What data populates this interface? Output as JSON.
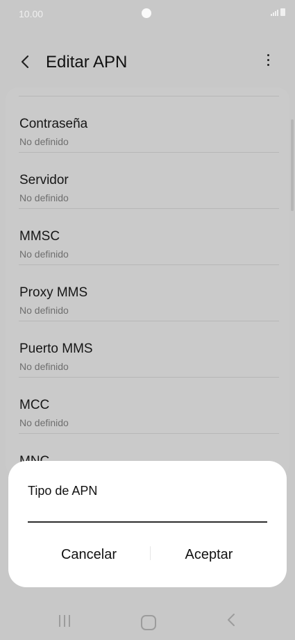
{
  "status_bar": {
    "time": "10.00"
  },
  "header": {
    "title": "Editar APN"
  },
  "settings": [
    {
      "label": "Contraseña",
      "value": "No definido"
    },
    {
      "label": "Servidor",
      "value": "No definido"
    },
    {
      "label": "MMSC",
      "value": "No definido"
    },
    {
      "label": "Proxy MMS",
      "value": "No definido"
    },
    {
      "label": "Puerto MMS",
      "value": "No definido"
    },
    {
      "label": "MCC",
      "value": "No definido"
    },
    {
      "label": "MNC",
      "value": ""
    }
  ],
  "dialog": {
    "title": "Tipo de APN",
    "input_value": "",
    "cancel_label": "Cancelar",
    "ok_label": "Aceptar"
  },
  "icons": {
    "back": "back-arrow-icon",
    "more": "more-options-icon",
    "signal": "signal-icon",
    "battery": "battery-icon",
    "nav_recent": "recent-apps-icon",
    "nav_home": "home-icon",
    "nav_back": "back-nav-icon"
  }
}
